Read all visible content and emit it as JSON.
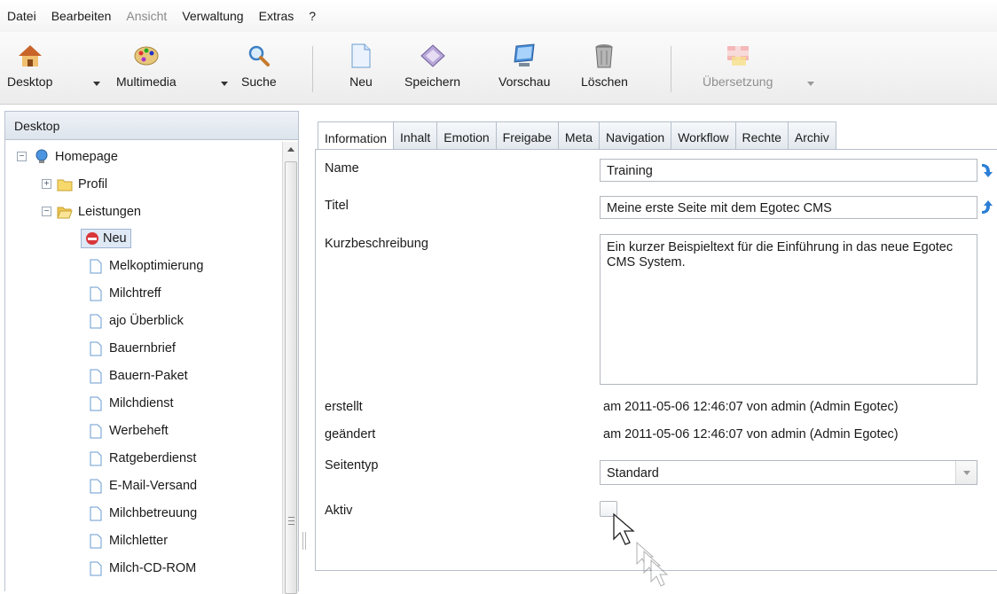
{
  "menu": {
    "items": [
      {
        "label": "Datei",
        "enabled": true
      },
      {
        "label": "Bearbeiten",
        "enabled": true
      },
      {
        "label": "Ansicht",
        "enabled": false
      },
      {
        "label": "Verwaltung",
        "enabled": true
      },
      {
        "label": "Extras",
        "enabled": true
      },
      {
        "label": "?",
        "enabled": true
      }
    ]
  },
  "toolbar": {
    "desktop": "Desktop",
    "multimedia": "Multimedia",
    "suche": "Suche",
    "neu": "Neu",
    "speichern": "Speichern",
    "vorschau": "Vorschau",
    "loeschen": "Löschen",
    "uebersetzung": "Übersetzung"
  },
  "left_panel": {
    "title": "Desktop",
    "tree": {
      "root": "Homepage",
      "profil": "Profil",
      "leistungen": "Leistungen",
      "selected": "Neu",
      "children": [
        "Melkoptimierung",
        "Milchtreff",
        "ajo Überblick",
        "Bauernbrief",
        "Bauern-Paket",
        "Milchdienst",
        "Werbeheft",
        "Ratgeberdienst",
        "E-Mail-Versand",
        "Milchbetreuung",
        "Milchletter",
        "Milch-CD-ROM"
      ]
    }
  },
  "tabs": [
    "Information",
    "Inhalt",
    "Emotion",
    "Freigabe",
    "Meta",
    "Navigation",
    "Workflow",
    "Rechte",
    "Archiv"
  ],
  "active_tab": "Information",
  "form": {
    "name_label": "Name",
    "name_value": "Training",
    "titel_label": "Titel",
    "titel_value": "Meine erste Seite mit dem Egotec CMS",
    "kurz_label": "Kurzbeschreibung",
    "kurz_value": "Ein kurzer Beispieltext für die Einführung in das neue Egotec CMS System.",
    "erstellt_label": "erstellt",
    "erstellt_value": "am 2011-05-06 12:46:07 von admin (Admin Egotec)",
    "geaendert_label": "geändert",
    "geaendert_value": "am 2011-05-06 12:46:07 von admin (Admin Egotec)",
    "seitentyp_label": "Seitentyp",
    "seitentyp_value": "Standard",
    "aktiv_label": "Aktiv",
    "aktiv_checked": false
  },
  "colors": {
    "accent_blue": "#2b7fd6",
    "panel_border": "#b5bfcb",
    "disabled_text": "#8a8a8a"
  }
}
